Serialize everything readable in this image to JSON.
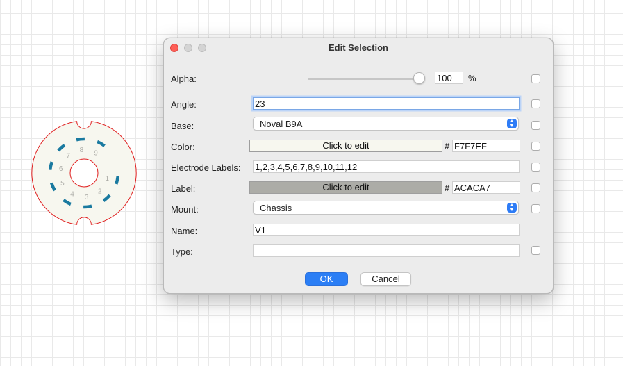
{
  "tube": {
    "pin_labels": [
      "1",
      "2",
      "3",
      "4",
      "5",
      "6",
      "7",
      "8",
      "9"
    ],
    "outline_color": "#e02020",
    "fill_color": "#F7F7EF",
    "pin_color": "#1a7aa0",
    "label_color": "#ACACA7"
  },
  "dialog": {
    "title": "Edit Selection",
    "window_controls": [
      "close",
      "minimize",
      "zoom"
    ],
    "fields": {
      "alpha": {
        "label": "Alpha:",
        "value": "100",
        "unit": "%",
        "level": 1.0
      },
      "angle": {
        "label": "Angle:",
        "value": "23"
      },
      "base": {
        "label": "Base:",
        "value": "Noval B9A"
      },
      "color": {
        "label": "Color:",
        "button": "Click to edit",
        "hash": "#",
        "hex": "F7F7EF",
        "swatch": "#F7F7EF"
      },
      "electrode_labels": {
        "label": "Electrode Labels:",
        "value": "1,2,3,4,5,6,7,8,9,10,11,12"
      },
      "label_color": {
        "label": "Label:",
        "button": "Click to edit",
        "hash": "#",
        "hex": "ACACA7",
        "swatch": "#ACACA7"
      },
      "mount": {
        "label": "Mount:",
        "value": "Chassis"
      },
      "name": {
        "label": "Name:",
        "value": "V1"
      },
      "type": {
        "label": "Type:",
        "value": ""
      }
    },
    "buttons": {
      "ok": "OK",
      "cancel": "Cancel"
    },
    "accent_color": "#2b7ef5"
  }
}
